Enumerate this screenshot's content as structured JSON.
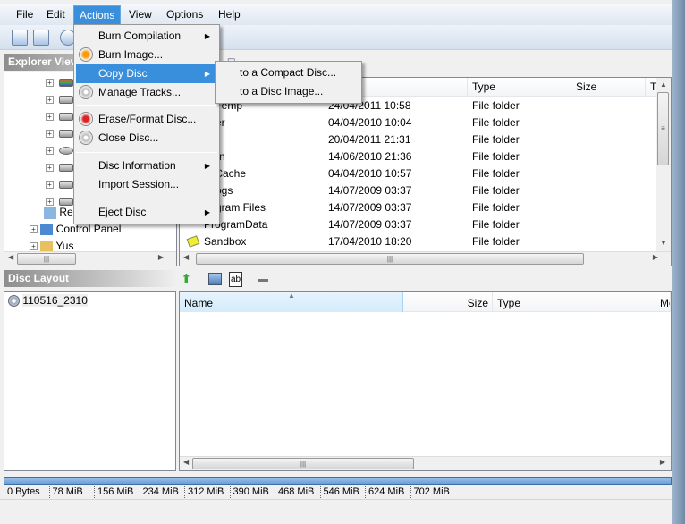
{
  "menubar": {
    "items": [
      "File",
      "Edit",
      "Actions",
      "View",
      "Options",
      "Help"
    ],
    "active": "Actions"
  },
  "explorer": {
    "title": "Explorer View",
    "tree": [
      {
        "label": "Re"
      },
      {
        "label": "Control Panel"
      },
      {
        "label": "Yus"
      }
    ]
  },
  "file_list": {
    "columns": [
      "Type",
      "Size",
      "T"
    ],
    "rows": [
      {
        "name": "roTemp",
        "date": "24/04/2011 10:58",
        "type": "File folder"
      },
      {
        "name": "ther",
        "date": "04/04/2010 10:04",
        "type": "File folder"
      },
      {
        "name": "",
        "date": "20/04/2011 21:31",
        "type": "File folder"
      },
      {
        "name": "Win",
        "date": "14/06/2010 21:36",
        "type": "File folder"
      },
      {
        "name": "OCache",
        "date": "04/04/2010 10:57",
        "type": "File folder"
      },
      {
        "name": "fLogs",
        "date": "14/07/2009 03:37",
        "type": "File folder"
      },
      {
        "name": "gram Files",
        "date": "14/07/2009 03:37",
        "type": "File folder"
      },
      {
        "name": "ProgramData",
        "date": "14/07/2009 03:37",
        "type": "File folder"
      },
      {
        "name": "Sandbox",
        "date": "17/04/2010 18:20",
        "type": "File folder"
      }
    ]
  },
  "disc_layout": {
    "title": "Disc Layout",
    "disc_name": "110516_2310",
    "columns": [
      "Name",
      "Size",
      "Type",
      "Mo"
    ]
  },
  "capacity": {
    "used_fraction": 0,
    "scale": [
      "0 Bytes",
      "78 MiB",
      "156 MiB",
      "234 MiB",
      "312 MiB",
      "390 MiB",
      "468 MiB",
      "546 MiB",
      "624 MiB",
      "702 MiB"
    ]
  },
  "actions_menu": {
    "items": [
      {
        "label": "Burn Compilation",
        "submenu": true,
        "icon": ""
      },
      {
        "label": "Burn Image...",
        "icon": "burn-image-icon"
      },
      {
        "label": "Copy Disc",
        "submenu": true,
        "highlighted": true,
        "icon": ""
      },
      {
        "label": "Manage Tracks...",
        "icon": "manage-tracks-icon"
      },
      {
        "label": "Erase/Format Disc...",
        "icon": "erase-disc-icon"
      },
      {
        "label": "Close Disc...",
        "icon": "close-disc-icon"
      },
      {
        "label": "Disc Information",
        "submenu": true,
        "icon": ""
      },
      {
        "label": "Import Session...",
        "icon": ""
      },
      {
        "label": "Eject Disc",
        "submenu": true,
        "icon": ""
      }
    ]
  },
  "copy_disc_submenu": {
    "items": [
      "to a Compact Disc...",
      "to a Disc Image..."
    ]
  },
  "colors": {
    "highlight": "#3a8fdc",
    "header_gray": "#8d8d8d"
  }
}
